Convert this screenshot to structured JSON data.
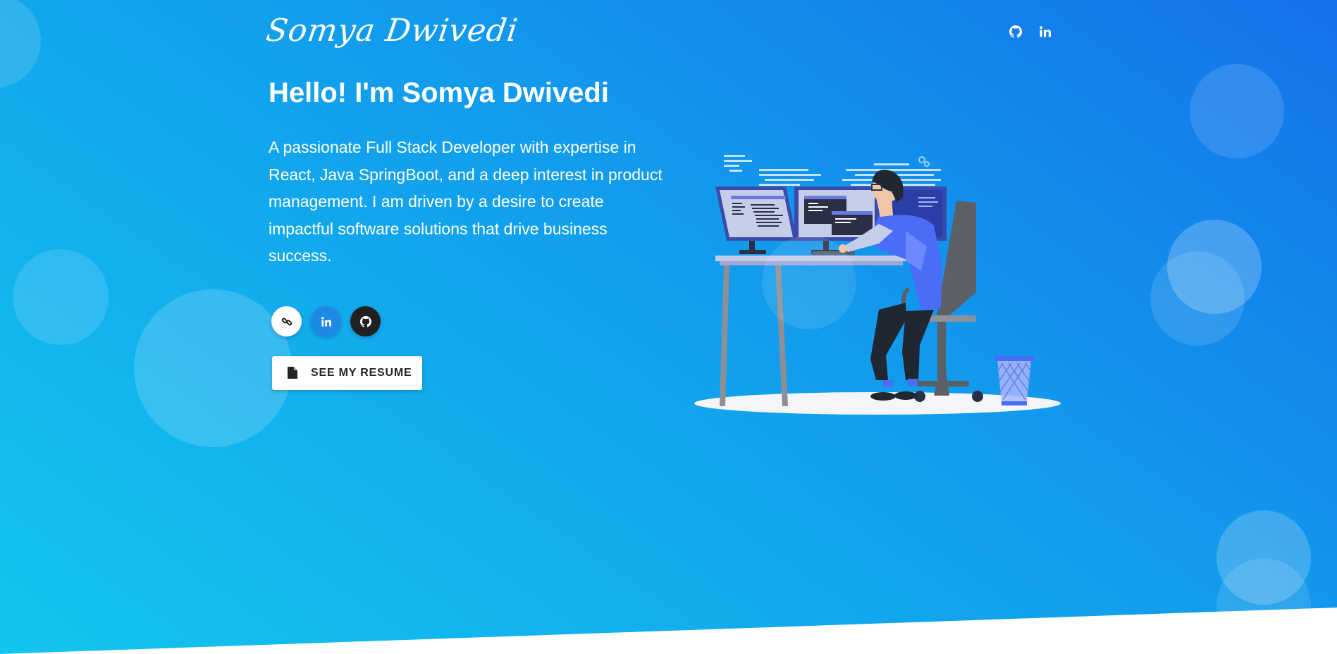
{
  "header": {
    "logo_text": "Somya Dwivedi",
    "nav_icons": [
      "github-icon",
      "linkedin-icon"
    ]
  },
  "hero": {
    "title": "Hello! I'm Somya Dwivedi",
    "description": "A passionate Full Stack Developer with expertise in React, Java SpringBoot, and a deep interest in product management. I am driven by a desire to create impactful software solutions that drive business success.",
    "social_icons": [
      "link-icon",
      "linkedin-icon",
      "github-icon"
    ],
    "resume_button_label": "SEE MY RESUME"
  },
  "colors": {
    "gradient_top": "#1472ec",
    "gradient_bottom": "#12c6ef",
    "linkedin_blue": "#1e88e5",
    "github_dark": "#212121",
    "illustration_accent": "#4a6cf7"
  }
}
